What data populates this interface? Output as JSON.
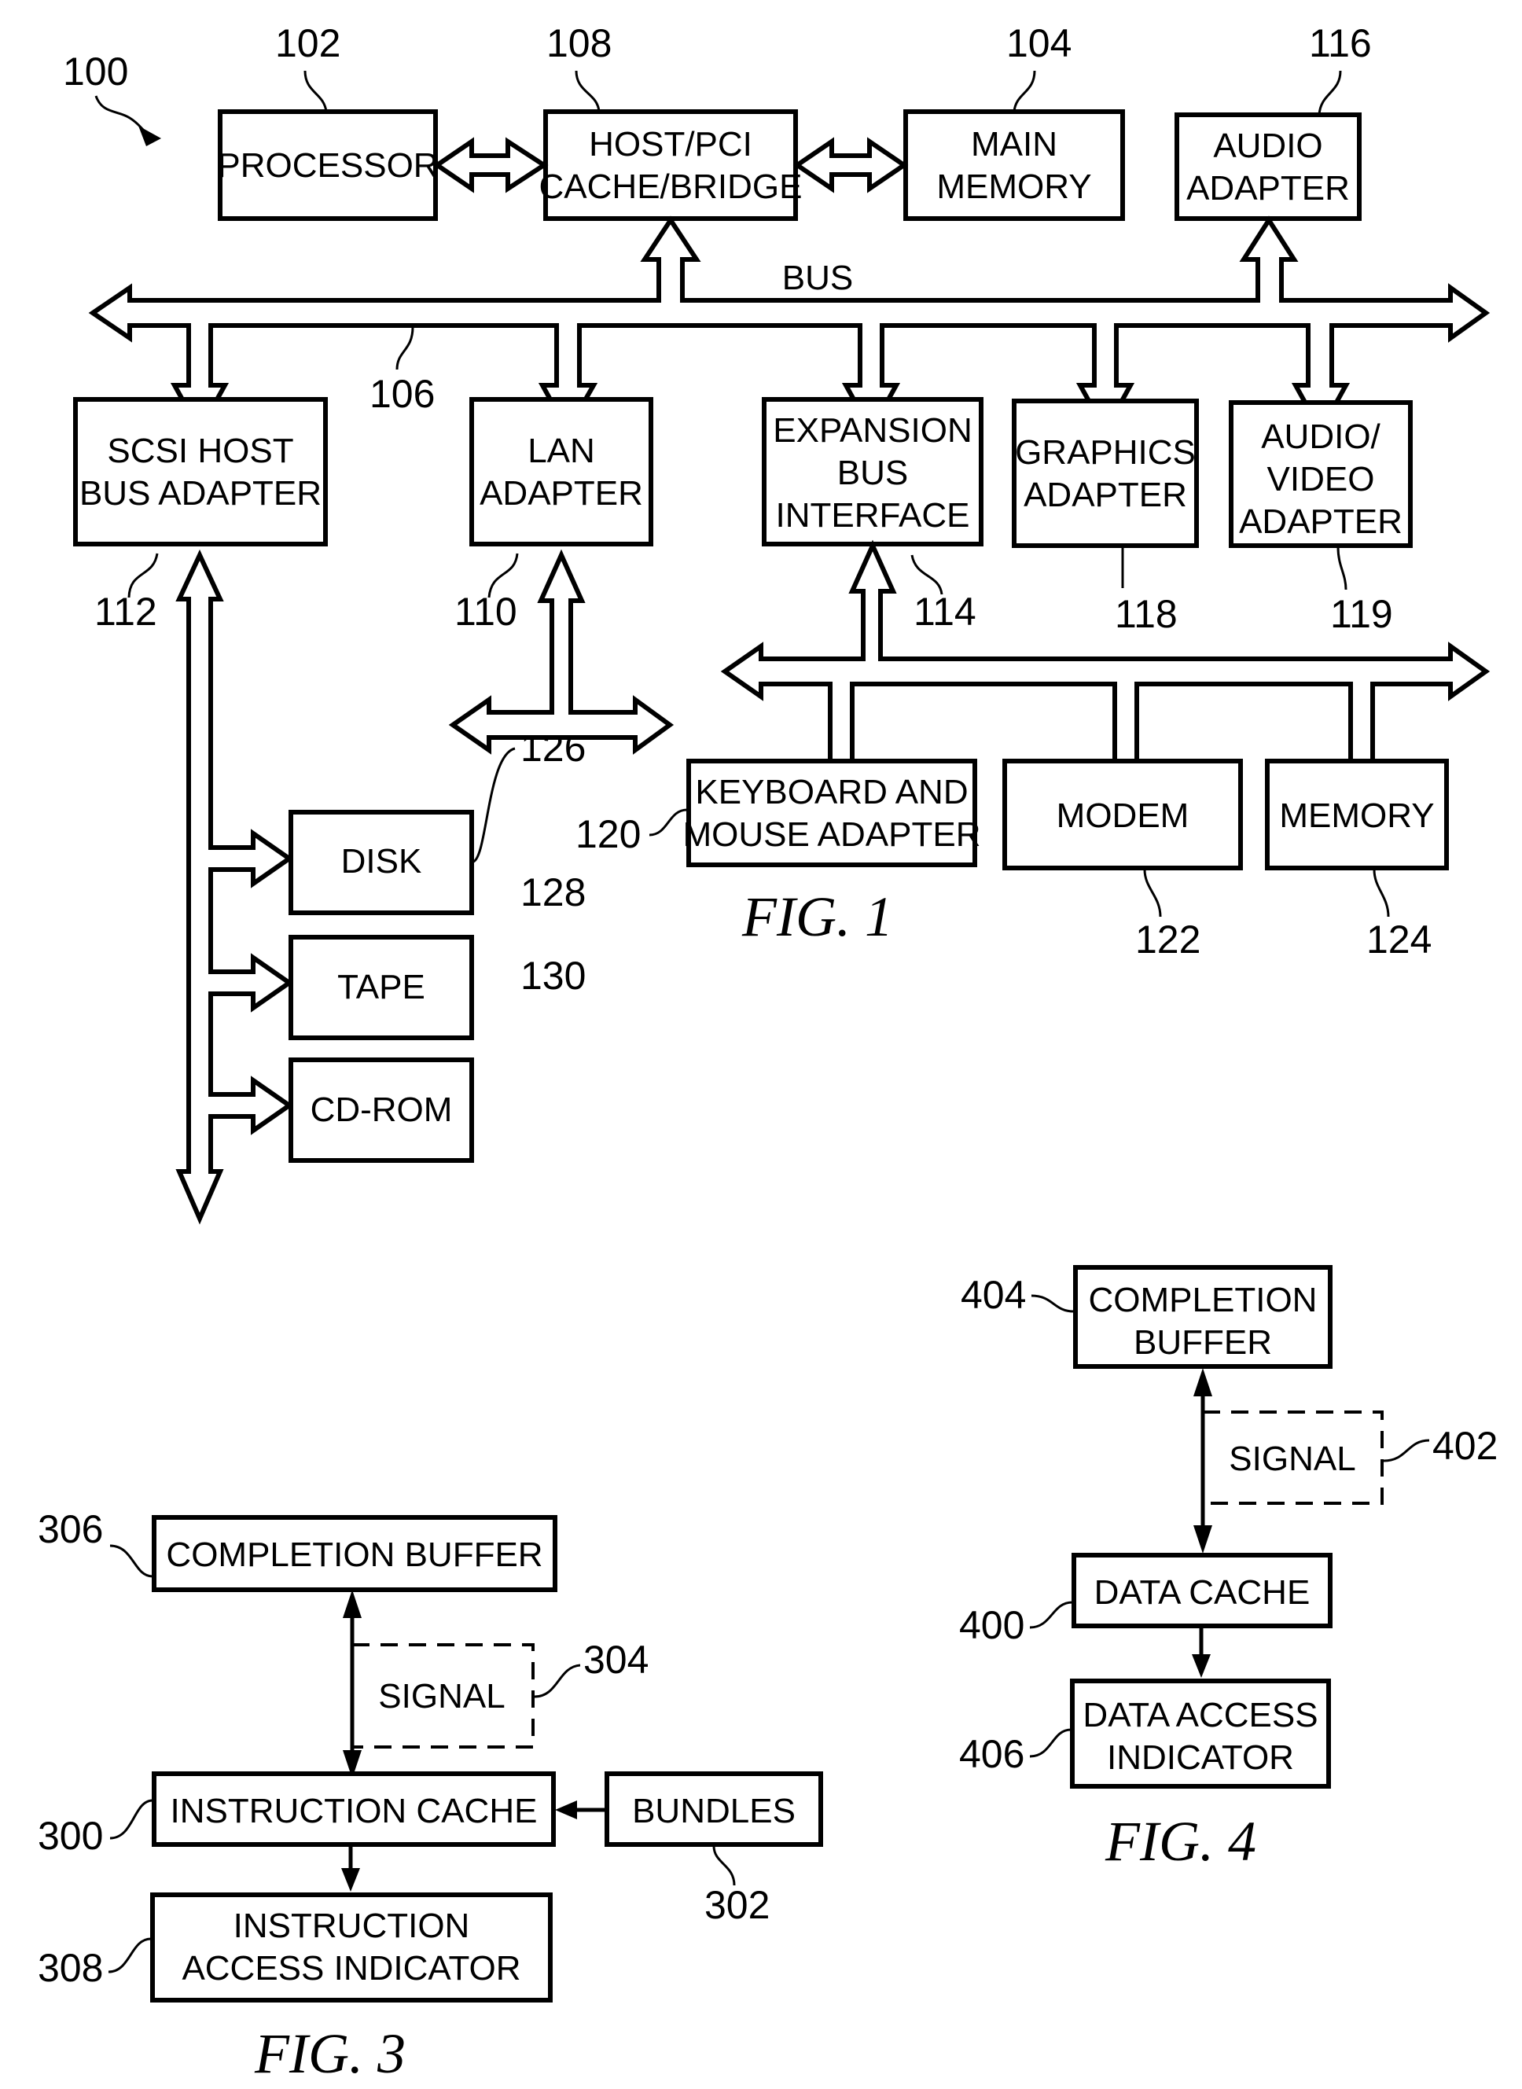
{
  "fig1": {
    "caption": "FIG. 1",
    "system_ref": "100",
    "bus_label": "BUS",
    "bus_ref": "106",
    "blocks": {
      "processor": {
        "lines": [
          "PROCESSOR"
        ],
        "ref": "102"
      },
      "host_bridge": {
        "lines": [
          "HOST/PCI",
          "CACHE/BRIDGE"
        ],
        "ref": "108"
      },
      "main_memory": {
        "lines": [
          "MAIN",
          "MEMORY"
        ],
        "ref": "104"
      },
      "audio_adapter": {
        "lines": [
          "AUDIO",
          "ADAPTER"
        ],
        "ref": "116"
      },
      "scsi": {
        "lines": [
          "SCSI HOST",
          "BUS ADAPTER"
        ],
        "ref": "112"
      },
      "lan": {
        "lines": [
          "LAN",
          "ADAPTER"
        ],
        "ref": "110"
      },
      "expansion": {
        "lines": [
          "EXPANSION",
          "BUS",
          "INTERFACE"
        ],
        "ref": "114"
      },
      "graphics": {
        "lines": [
          "GRAPHICS",
          "ADAPTER"
        ],
        "ref": "118"
      },
      "av_adapter": {
        "lines": [
          "AUDIO/",
          "VIDEO",
          "ADAPTER"
        ],
        "ref": "119"
      },
      "disk": {
        "lines": [
          "DISK"
        ],
        "ref": "126"
      },
      "tape": {
        "lines": [
          "TAPE"
        ],
        "ref": "128"
      },
      "cdrom": {
        "lines": [
          "CD-ROM"
        ],
        "ref": "130"
      },
      "kbd_mouse": {
        "lines": [
          "KEYBOARD AND",
          "MOUSE ADAPTER"
        ],
        "ref": "120"
      },
      "modem": {
        "lines": [
          "MODEM"
        ],
        "ref": "122"
      },
      "memory": {
        "lines": [
          "MEMORY"
        ],
        "ref": "124"
      }
    }
  },
  "fig3": {
    "caption": "FIG. 3",
    "blocks": {
      "completion_buffer": {
        "lines": [
          "COMPLETION BUFFER"
        ],
        "ref": "306"
      },
      "signal": {
        "lines": [
          "SIGNAL"
        ],
        "ref": "304"
      },
      "instruction_cache": {
        "lines": [
          "INSTRUCTION CACHE"
        ],
        "ref": "300"
      },
      "bundles": {
        "lines": [
          "BUNDLES"
        ],
        "ref": "302"
      },
      "access_indicator": {
        "lines": [
          "INSTRUCTION",
          "ACCESS INDICATOR"
        ],
        "ref": "308"
      }
    }
  },
  "fig4": {
    "caption": "FIG. 4",
    "blocks": {
      "completion_buffer": {
        "lines": [
          "COMPLETION",
          "BUFFER"
        ],
        "ref": "404"
      },
      "signal": {
        "lines": [
          "SIGNAL"
        ],
        "ref": "402"
      },
      "data_cache": {
        "lines": [
          "DATA CACHE"
        ],
        "ref": "400"
      },
      "access_indicator": {
        "lines": [
          "DATA ACCESS",
          "INDICATOR"
        ],
        "ref": "406"
      }
    }
  }
}
